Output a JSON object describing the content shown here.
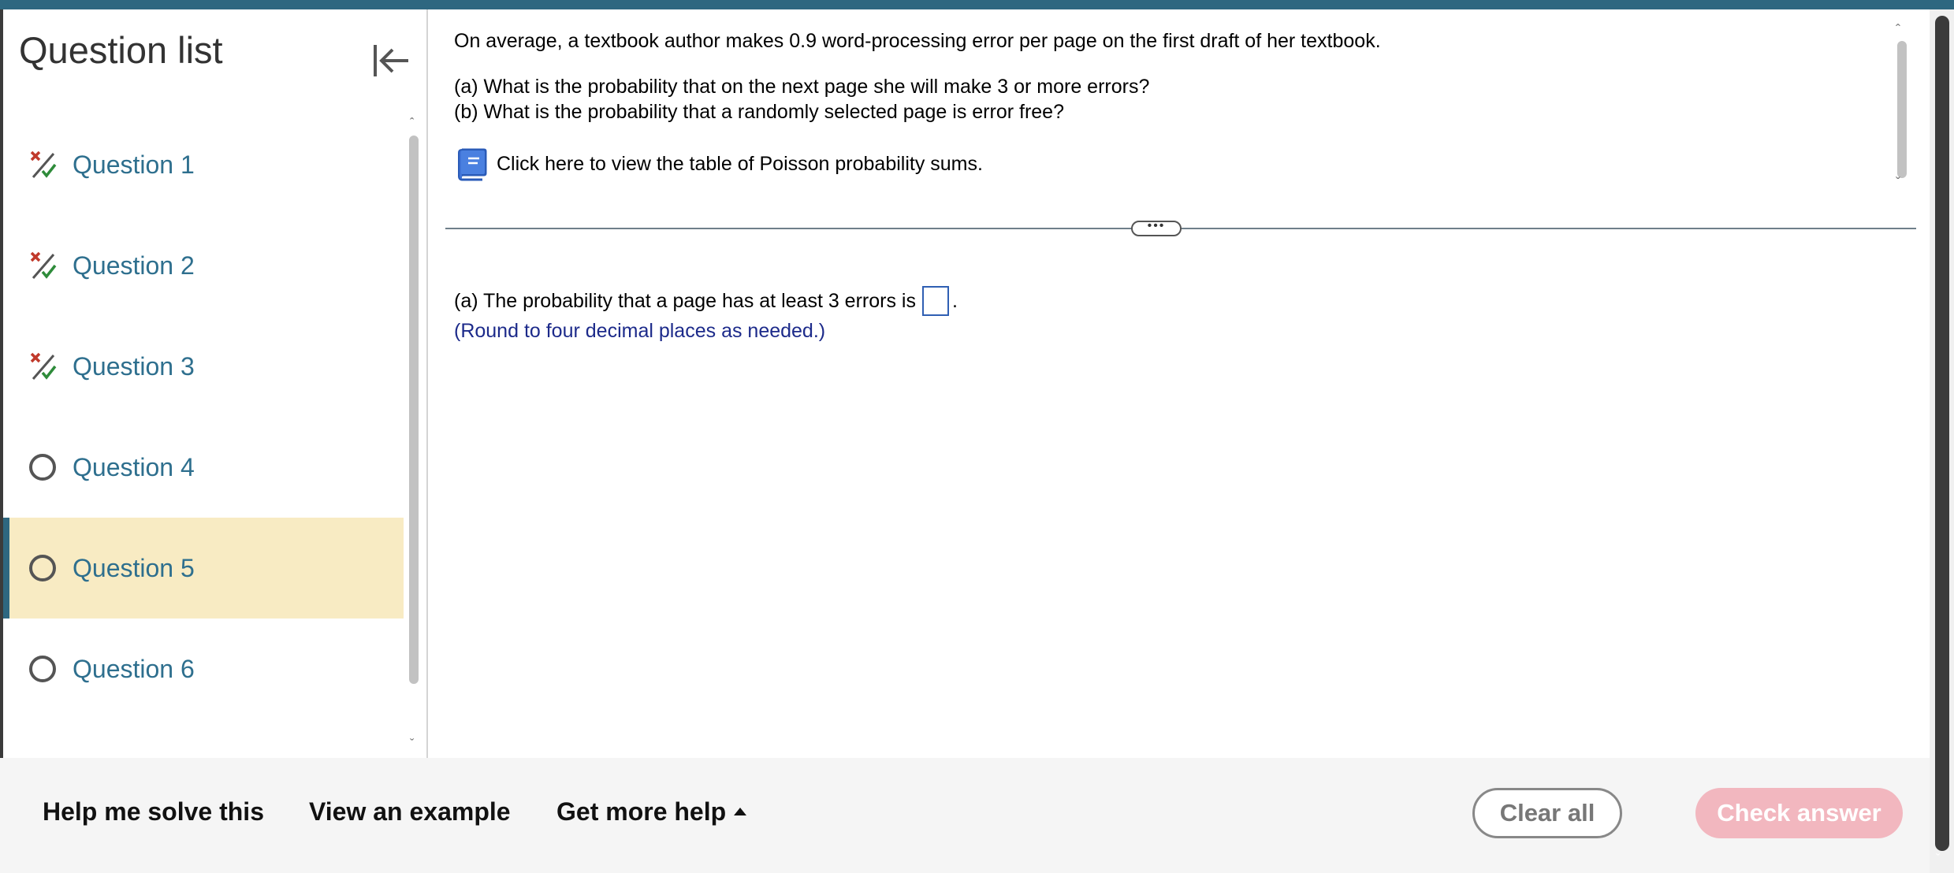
{
  "sidebar": {
    "title": "Question list",
    "items": [
      {
        "label": "Question 1",
        "status": "partial"
      },
      {
        "label": "Question 2",
        "status": "partial"
      },
      {
        "label": "Question 3",
        "status": "partial"
      },
      {
        "label": "Question 4",
        "status": "unanswered"
      },
      {
        "label": "Question 5",
        "status": "unanswered",
        "active": true
      },
      {
        "label": "Question 6",
        "status": "unanswered"
      }
    ]
  },
  "question": {
    "intro": "On average, a textbook author makes 0.9 word-processing error per page on the first draft of her textbook.",
    "part_a": "(a) What is the probability that on the next page she will make 3 or more errors?",
    "part_b": "(b) What is the probability that a randomly selected page is error free?",
    "table_link": "Click here to view the table of Poisson probability sums."
  },
  "answer": {
    "prompt": "(a) The probability that a page has at least 3 errors is",
    "suffix": ".",
    "value": "",
    "hint": "(Round to four decimal places as needed.)"
  },
  "footer": {
    "help_solve": "Help me solve this",
    "view_example": "View an example",
    "more_help": "Get more help",
    "clear_all": "Clear all",
    "check_answer": "Check answer"
  },
  "colors": {
    "accent": "#2e6780",
    "link": "#2e6f8e",
    "active_bg": "#f8ebc3",
    "hint": "#1c2a8a",
    "check_disabled": "#f2b7bf"
  },
  "icons": {
    "collapse": "collapse-left-icon",
    "partial": "partial-correct-icon",
    "unanswered": "circle-icon",
    "book": "book-icon"
  }
}
